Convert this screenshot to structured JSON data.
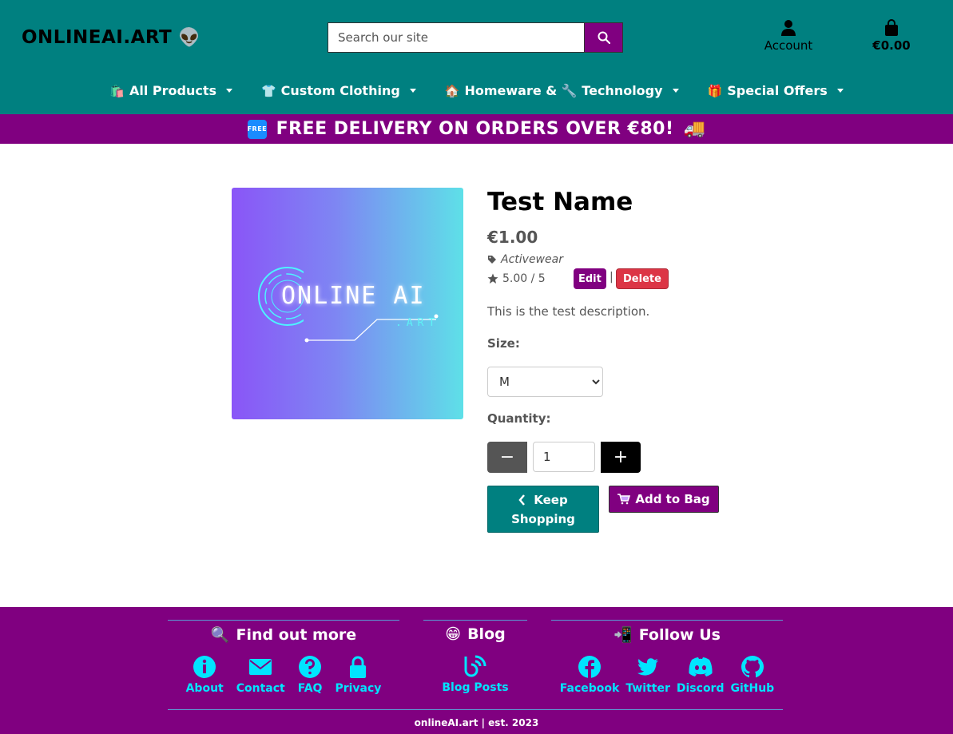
{
  "header": {
    "brand": "ONLINEAI.ART",
    "brand_emoji": "👽",
    "search_placeholder": "Search our site",
    "account_label": "Account",
    "bag_total": "€0.00"
  },
  "nav": [
    {
      "emoji": "🛍️",
      "label": "All Products"
    },
    {
      "emoji": "👕",
      "label": "Custom Clothing"
    },
    {
      "emoji": "🏠",
      "label": "Homeware & 🔧 Technology"
    },
    {
      "emoji": "🎁",
      "label": "Special Offers"
    }
  ],
  "promo": {
    "badge": "FREE",
    "text": "FREE DELIVERY ON ORDERS OVER €80!",
    "truck": "🚚"
  },
  "product": {
    "image_text": "ONLINE AI",
    "image_subtext": ".ART",
    "name": "Test Name",
    "price": "€1.00",
    "category": "Activewear",
    "rating": "5.00 / 5",
    "edit_label": "Edit",
    "separator": "|",
    "delete_label": "Delete",
    "description": "This is the test description.",
    "size_label": "Size:",
    "size_value": "M",
    "quantity_label": "Quantity:",
    "quantity_value": "1",
    "minus": "−",
    "plus": "+",
    "keep_line1": "Keep",
    "keep_line2": "Shopping",
    "add_to_bag": "Add to Bag"
  },
  "footer": {
    "find_title": "Find out more",
    "find_emoji": "🔍",
    "find_links": [
      "About",
      "Contact",
      "FAQ",
      "Privacy"
    ],
    "blog_title": "Blog",
    "blog_emoji": "😁",
    "blog_link": "Blog Posts",
    "follow_title": "Follow Us",
    "follow_emoji": "📲",
    "follow_links": [
      "Facebook",
      "Twitter",
      "Discord",
      "GitHub"
    ],
    "copyright": "onlineAI.art | est. 2023"
  },
  "colors": {
    "header_bg": "#008080",
    "promo_bg": "#800080",
    "footer_bg": "#800080",
    "footer_link": "#00e5ff",
    "delete_red": "#dc3545"
  }
}
